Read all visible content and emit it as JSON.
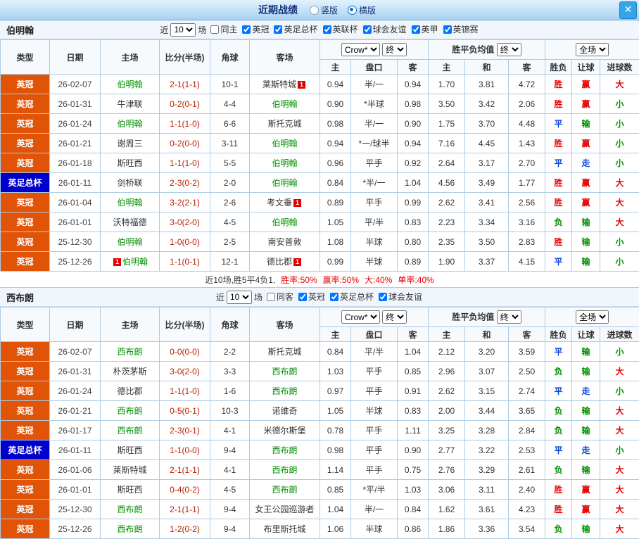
{
  "header": {
    "title": "近期战绩",
    "view_options": [
      {
        "label": "竖版",
        "selected": false
      },
      {
        "label": "横版",
        "selected": true
      }
    ],
    "close_label": "✕"
  },
  "colors": {
    "league_bg": "#e15408",
    "cup_bg": "#0000cc",
    "res_red": "#e60000",
    "res_green": "#009100",
    "res_blue": "#0b46d9",
    "team_green": "#009100",
    "score_red": "#bb2200"
  },
  "filter_labels": {
    "near": "近",
    "count": "10",
    "games": "场"
  },
  "columns": {
    "type": "类型",
    "date": "日期",
    "home": "主场",
    "score": "比分(半场)",
    "corner": "角球",
    "away": "客场",
    "company": "Crow*",
    "final": "终",
    "euro_label": "胜平负均值",
    "full": "全场",
    "ah_home": "主",
    "ah_pk": "盘口",
    "ah_away": "客",
    "eu_home": "主",
    "eu_draw": "和",
    "eu_away": "客",
    "r_wdl": "胜负",
    "r_handicap": "让球",
    "r_goals": "进球数"
  },
  "sections": [
    {
      "team": "伯明翰",
      "filter_checks": [
        {
          "label": "同主",
          "checked": false
        },
        {
          "label": "英冠",
          "checked": true
        },
        {
          "label": "英足总杯",
          "checked": true
        },
        {
          "label": "英联杯",
          "checked": true
        },
        {
          "label": "球会友谊",
          "checked": true
        },
        {
          "label": "英甲",
          "checked": true
        },
        {
          "label": "英锦赛",
          "checked": true
        }
      ],
      "rows": [
        {
          "type": "英冠",
          "cup": false,
          "date": "26-02-07",
          "home": "伯明翰",
          "home_green": true,
          "home_badge": "",
          "score": "2-1(1-1)",
          "corner": "10-1",
          "away": "莱斯特城",
          "away_green": false,
          "away_badge": "1",
          "ah": [
            "0.94",
            "半/一",
            "0.94"
          ],
          "eu": [
            "1.70",
            "3.81",
            "4.72"
          ],
          "results": [
            [
              "胜",
              "r"
            ],
            [
              "赢",
              "r"
            ],
            [
              "大",
              "r"
            ]
          ]
        },
        {
          "type": "英冠",
          "cup": false,
          "date": "26-01-31",
          "home": "牛津联",
          "home_green": false,
          "home_badge": "",
          "score": "0-2(0-1)",
          "corner": "4-4",
          "away": "伯明翰",
          "away_green": true,
          "away_badge": "",
          "ah": [
            "0.90",
            "*半球",
            "0.98"
          ],
          "eu": [
            "3.50",
            "3.42",
            "2.06"
          ],
          "results": [
            [
              "胜",
              "r"
            ],
            [
              "赢",
              "r"
            ],
            [
              "小",
              "g"
            ]
          ]
        },
        {
          "type": "英冠",
          "cup": false,
          "date": "26-01-24",
          "home": "伯明翰",
          "home_green": true,
          "home_badge": "",
          "score": "1-1(1-0)",
          "corner": "6-6",
          "away": "斯托克城",
          "away_green": false,
          "away_badge": "",
          "ah": [
            "0.98",
            "半/一",
            "0.90"
          ],
          "eu": [
            "1.75",
            "3.70",
            "4.48"
          ],
          "results": [
            [
              "平",
              "b"
            ],
            [
              "输",
              "g"
            ],
            [
              "小",
              "g"
            ]
          ]
        },
        {
          "type": "英冠",
          "cup": false,
          "date": "26-01-21",
          "home": "谢周三",
          "home_green": false,
          "home_badge": "",
          "score": "0-2(0-0)",
          "corner": "3-11",
          "away": "伯明翰",
          "away_green": true,
          "away_badge": "",
          "ah": [
            "0.94",
            "*一/球半",
            "0.94"
          ],
          "eu": [
            "7.16",
            "4.45",
            "1.43"
          ],
          "results": [
            [
              "胜",
              "r"
            ],
            [
              "赢",
              "r"
            ],
            [
              "小",
              "g"
            ]
          ]
        },
        {
          "type": "英冠",
          "cup": false,
          "date": "26-01-18",
          "home": "斯旺西",
          "home_green": false,
          "home_badge": "",
          "score": "1-1(1-0)",
          "corner": "5-5",
          "away": "伯明翰",
          "away_green": true,
          "away_badge": "",
          "ah": [
            "0.96",
            "平手",
            "0.92"
          ],
          "eu": [
            "2.64",
            "3.17",
            "2.70"
          ],
          "results": [
            [
              "平",
              "b"
            ],
            [
              "走",
              "b"
            ],
            [
              "小",
              "g"
            ]
          ]
        },
        {
          "type": "英足总杯",
          "cup": true,
          "date": "26-01-11",
          "home": "剑桥联",
          "home_green": false,
          "home_badge": "",
          "score": "2-3(0-2)",
          "corner": "2-0",
          "away": "伯明翰",
          "away_green": true,
          "away_badge": "",
          "ah": [
            "0.84",
            "*半/一",
            "1.04"
          ],
          "eu": [
            "4.56",
            "3.49",
            "1.77"
          ],
          "results": [
            [
              "胜",
              "r"
            ],
            [
              "赢",
              "r"
            ],
            [
              "大",
              "r"
            ]
          ]
        },
        {
          "type": "英冠",
          "cup": false,
          "date": "26-01-04",
          "home": "伯明翰",
          "home_green": true,
          "home_badge": "",
          "score": "3-2(2-1)",
          "corner": "2-6",
          "away": "考文垂",
          "away_green": false,
          "away_badge": "1",
          "ah": [
            "0.89",
            "平手",
            "0.99"
          ],
          "eu": [
            "2.62",
            "3.41",
            "2.56"
          ],
          "results": [
            [
              "胜",
              "r"
            ],
            [
              "赢",
              "r"
            ],
            [
              "大",
              "r"
            ]
          ]
        },
        {
          "type": "英冠",
          "cup": false,
          "date": "26-01-01",
          "home": "沃特福德",
          "home_green": false,
          "home_badge": "",
          "score": "3-0(2-0)",
          "corner": "4-5",
          "away": "伯明翰",
          "away_green": true,
          "away_badge": "",
          "ah": [
            "1.05",
            "平/半",
            "0.83"
          ],
          "eu": [
            "2.23",
            "3.34",
            "3.16"
          ],
          "results": [
            [
              "负",
              "g"
            ],
            [
              "输",
              "g"
            ],
            [
              "大",
              "r"
            ]
          ]
        },
        {
          "type": "英冠",
          "cup": false,
          "date": "25-12-30",
          "home": "伯明翰",
          "home_green": true,
          "home_badge": "",
          "score": "1-0(0-0)",
          "corner": "2-5",
          "away": "南安普敦",
          "away_green": false,
          "away_badge": "",
          "ah": [
            "1.08",
            "半球",
            "0.80"
          ],
          "eu": [
            "2.35",
            "3.50",
            "2.83"
          ],
          "results": [
            [
              "胜",
              "r"
            ],
            [
              "输",
              "g"
            ],
            [
              "小",
              "g"
            ]
          ]
        },
        {
          "type": "英冠",
          "cup": false,
          "date": "25-12-26",
          "home": "伯明翰",
          "home_green": true,
          "home_badge": "1",
          "score": "1-1(0-1)",
          "corner": "12-1",
          "away": "德比郡",
          "away_green": false,
          "away_badge": "1",
          "ah": [
            "0.99",
            "半球",
            "0.89"
          ],
          "eu": [
            "1.90",
            "3.37",
            "4.15"
          ],
          "results": [
            [
              "平",
              "b"
            ],
            [
              "输",
              "g"
            ],
            [
              "小",
              "g"
            ]
          ]
        }
      ],
      "summary_parts": [
        {
          "t": "近10场,胜5平4负1,",
          "c": ""
        },
        {
          "t": "胜率:50%",
          "c": "r"
        },
        {
          "t": "赢率:50%",
          "c": "r"
        },
        {
          "t": "大:40%",
          "c": "r"
        },
        {
          "t": "单率:40%",
          "c": "r"
        }
      ]
    },
    {
      "team": "西布朗",
      "filter_checks": [
        {
          "label": "同客",
          "checked": false
        },
        {
          "label": "英冠",
          "checked": true
        },
        {
          "label": "英足总杯",
          "checked": true
        },
        {
          "label": "球会友谊",
          "checked": true
        }
      ],
      "rows": [
        {
          "type": "英冠",
          "cup": false,
          "date": "26-02-07",
          "home": "西布朗",
          "home_green": true,
          "home_badge": "",
          "score": "0-0(0-0)",
          "corner": "2-2",
          "away": "斯托克城",
          "away_green": false,
          "away_badge": "",
          "ah": [
            "0.84",
            "平/半",
            "1.04"
          ],
          "eu": [
            "2.12",
            "3.20",
            "3.59"
          ],
          "results": [
            [
              "平",
              "b"
            ],
            [
              "输",
              "g"
            ],
            [
              "小",
              "g"
            ]
          ]
        },
        {
          "type": "英冠",
          "cup": false,
          "date": "26-01-31",
          "home": "朴茨茅斯",
          "home_green": false,
          "home_badge": "",
          "score": "3-0(2-0)",
          "corner": "3-3",
          "away": "西布朗",
          "away_green": true,
          "away_badge": "",
          "ah": [
            "1.03",
            "平手",
            "0.85"
          ],
          "eu": [
            "2.96",
            "3.07",
            "2.50"
          ],
          "results": [
            [
              "负",
              "g"
            ],
            [
              "输",
              "g"
            ],
            [
              "大",
              "r"
            ]
          ]
        },
        {
          "type": "英冠",
          "cup": false,
          "date": "26-01-24",
          "home": "德比郡",
          "home_green": false,
          "home_badge": "",
          "score": "1-1(1-0)",
          "corner": "1-6",
          "away": "西布朗",
          "away_green": true,
          "away_badge": "",
          "ah": [
            "0.97",
            "平手",
            "0.91"
          ],
          "eu": [
            "2.62",
            "3.15",
            "2.74"
          ],
          "results": [
            [
              "平",
              "b"
            ],
            [
              "走",
              "b"
            ],
            [
              "小",
              "g"
            ]
          ]
        },
        {
          "type": "英冠",
          "cup": false,
          "date": "26-01-21",
          "home": "西布朗",
          "home_green": true,
          "home_badge": "",
          "score": "0-5(0-1)",
          "corner": "10-3",
          "away": "诺维奇",
          "away_green": false,
          "away_badge": "",
          "ah": [
            "1.05",
            "半球",
            "0.83"
          ],
          "eu": [
            "2.00",
            "3.44",
            "3.65"
          ],
          "results": [
            [
              "负",
              "g"
            ],
            [
              "输",
              "g"
            ],
            [
              "大",
              "r"
            ]
          ]
        },
        {
          "type": "英冠",
          "cup": false,
          "date": "26-01-17",
          "home": "西布朗",
          "home_green": true,
          "home_badge": "",
          "score": "2-3(0-1)",
          "corner": "4-1",
          "away": "米德尔斯堡",
          "away_green": false,
          "away_badge": "",
          "ah": [
            "0.78",
            "平手",
            "1.11"
          ],
          "eu": [
            "3.25",
            "3.28",
            "2.84"
          ],
          "results": [
            [
              "负",
              "g"
            ],
            [
              "输",
              "g"
            ],
            [
              "大",
              "r"
            ]
          ]
        },
        {
          "type": "英足总杯",
          "cup": true,
          "date": "26-01-11",
          "home": "斯旺西",
          "home_green": false,
          "home_badge": "",
          "score": "1-1(0-0)",
          "corner": "9-4",
          "away": "西布朗",
          "away_green": true,
          "away_badge": "",
          "ah": [
            "0.98",
            "平手",
            "0.90"
          ],
          "eu": [
            "2.77",
            "3.22",
            "2.53"
          ],
          "results": [
            [
              "平",
              "b"
            ],
            [
              "走",
              "b"
            ],
            [
              "小",
              "g"
            ]
          ]
        },
        {
          "type": "英冠",
          "cup": false,
          "date": "26-01-06",
          "home": "莱斯特城",
          "home_green": false,
          "home_badge": "",
          "score": "2-1(1-1)",
          "corner": "4-1",
          "away": "西布朗",
          "away_green": true,
          "away_badge": "",
          "ah": [
            "1.14",
            "平手",
            "0.75"
          ],
          "eu": [
            "2.76",
            "3.29",
            "2.61"
          ],
          "results": [
            [
              "负",
              "g"
            ],
            [
              "输",
              "g"
            ],
            [
              "大",
              "r"
            ]
          ]
        },
        {
          "type": "英冠",
          "cup": false,
          "date": "26-01-01",
          "home": "斯旺西",
          "home_green": false,
          "home_badge": "",
          "score": "0-4(0-2)",
          "corner": "4-5",
          "away": "西布朗",
          "away_green": true,
          "away_badge": "",
          "ah": [
            "0.85",
            "*平/半",
            "1.03"
          ],
          "eu": [
            "3.06",
            "3.11",
            "2.40"
          ],
          "results": [
            [
              "胜",
              "r"
            ],
            [
              "赢",
              "r"
            ],
            [
              "大",
              "r"
            ]
          ]
        },
        {
          "type": "英冠",
          "cup": false,
          "date": "25-12-30",
          "home": "西布朗",
          "home_green": true,
          "home_badge": "",
          "score": "2-1(1-1)",
          "corner": "9-4",
          "away": "女王公园巡游者",
          "away_green": false,
          "away_badge": "",
          "ah": [
            "1.04",
            "半/一",
            "0.84"
          ],
          "eu": [
            "1.62",
            "3.61",
            "4.23"
          ],
          "results": [
            [
              "胜",
              "r"
            ],
            [
              "赢",
              "r"
            ],
            [
              "大",
              "r"
            ]
          ]
        },
        {
          "type": "英冠",
          "cup": false,
          "date": "25-12-26",
          "home": "西布朗",
          "home_green": true,
          "home_badge": "",
          "score": "1-2(0-2)",
          "corner": "9-4",
          "away": "布里斯托城",
          "away_green": false,
          "away_badge": "",
          "ah": [
            "1.06",
            "半球",
            "0.86"
          ],
          "eu": [
            "1.86",
            "3.36",
            "3.54"
          ],
          "results": [
            [
              "负",
              "g"
            ],
            [
              "输",
              "g"
            ],
            [
              "大",
              "r"
            ]
          ]
        }
      ]
    }
  ]
}
